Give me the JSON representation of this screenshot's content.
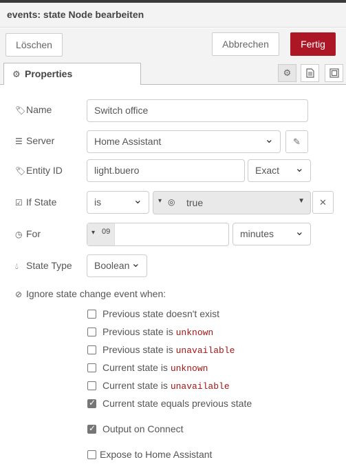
{
  "dialog": {
    "title": "events: state Node bearbeiten"
  },
  "buttons": {
    "delete": "Löschen",
    "cancel": "Abbrechen",
    "done": "Fertig"
  },
  "tabs": {
    "properties": "Properties"
  },
  "tab_icons": {
    "properties": "gear-icon",
    "description": "file-icon",
    "appearance": "frame-icon"
  },
  "form": {
    "name": {
      "label": "Name",
      "value": "Switch office"
    },
    "server": {
      "label": "Server",
      "value": "Home Assistant"
    },
    "entity_id": {
      "label": "Entity ID",
      "value": "light.buero",
      "match": "Exact"
    },
    "if_state": {
      "label": "If State",
      "operator": "is",
      "value": "true"
    },
    "for": {
      "label": "For",
      "type_symbol": "09",
      "value": "",
      "unit": "minutes"
    },
    "state_type": {
      "label": "State Type",
      "value": "Boolean"
    },
    "ignore": {
      "heading": "Ignore state change event when:",
      "items": [
        {
          "text": "Previous state doesn't exist",
          "code": "",
          "checked": false
        },
        {
          "text": "Previous state is ",
          "code": "unknown",
          "checked": false
        },
        {
          "text": "Previous state is ",
          "code": "unavailable",
          "checked": false
        },
        {
          "text": "Current state is ",
          "code": "unknown",
          "checked": false
        },
        {
          "text": "Current state is ",
          "code": "unavailable",
          "checked": false
        },
        {
          "text": "Current state equals previous state",
          "code": "",
          "checked": true
        }
      ]
    },
    "output_on_connect": {
      "label": "Output on Connect",
      "checked": true
    },
    "expose": {
      "label": "Expose to Home Assistant",
      "checked": false
    }
  },
  "colors": {
    "primary": "#ad1625",
    "code": "#a31515"
  }
}
